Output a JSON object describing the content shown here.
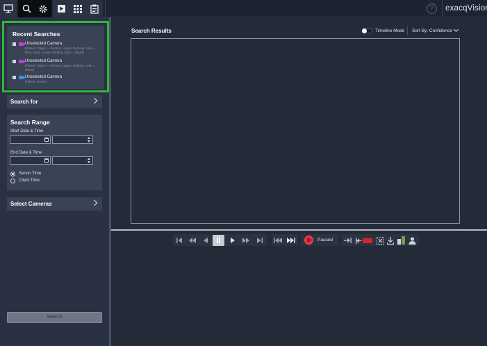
{
  "brand": "exacqVision",
  "toolbar": {
    "help": "?",
    "icons": [
      "monitor-icon",
      "search-icon",
      "gear-icon",
      "playback-icon",
      "grid-icon",
      "clipboard-icon"
    ]
  },
  "recent": {
    "title": "Recent Searches",
    "items": [
      {
        "name": "Unselected Camera",
        "filter": "[Filters: Object = Person, Upper clothing color = Blue, Red, Lower clothing color = Black]",
        "color": "#c23fd6"
      },
      {
        "name": "Unselected Camera",
        "filter": "[Filters: Object = Person, Upper clothing color = Black]",
        "color": "#c23fd6"
      },
      {
        "name": "Unselected Camera",
        "filter": "[Filters: Event]",
        "color": "#3d8fe0"
      }
    ]
  },
  "search_for": {
    "label": "Search for"
  },
  "range": {
    "title": "Search Range",
    "start_label": "Start Date & Time",
    "end_label": "End Date & Time",
    "server_time": "Server Time",
    "client_time": "Client Time",
    "selected": "server"
  },
  "select_cameras": {
    "label": "Select Cameras"
  },
  "search_button": "Search",
  "results": {
    "title": "Search Results",
    "timeline_label": "Timeline Mode",
    "sort_label": "Sort By: Confidence"
  },
  "playback": {
    "status": "Paused",
    "accent": "#d3262c"
  }
}
